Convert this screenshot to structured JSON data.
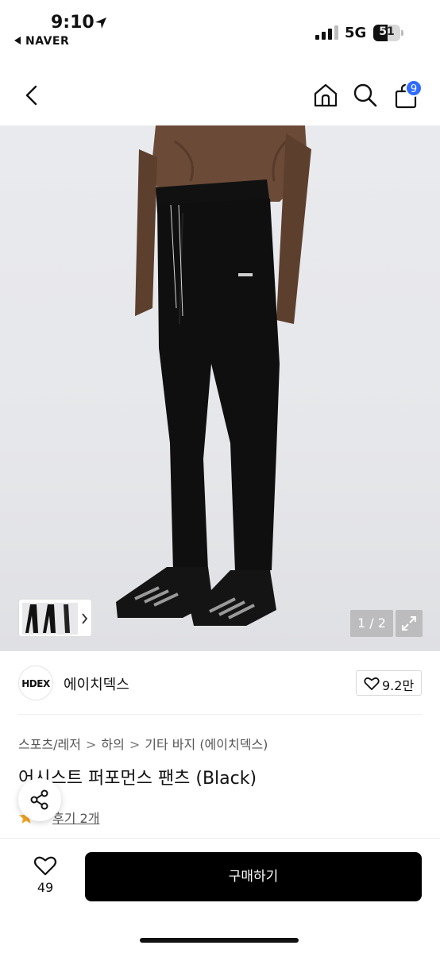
{
  "status_bar": {
    "time": "9:10",
    "back_app": "NAVER",
    "network": "5G",
    "battery": "51"
  },
  "header": {
    "cart_count": "9"
  },
  "gallery": {
    "counter": "1 / 2"
  },
  "brand": {
    "logo_text": "HDEX",
    "name": "에이치덱스",
    "likes": "9.2만"
  },
  "breadcrumb": {
    "items": [
      "스포츠/레저",
      "하의",
      "기타 바지 (에이치덱스)"
    ]
  },
  "product": {
    "title": "어시스트 퍼포먼스 팬츠 (Black)",
    "review_label": "후기 2개"
  },
  "bottom": {
    "wish_count": "49",
    "buy_label": "구매하기"
  },
  "colors": {
    "accent": "#2f6bff",
    "button": "#000000",
    "star": "#f5a623"
  }
}
